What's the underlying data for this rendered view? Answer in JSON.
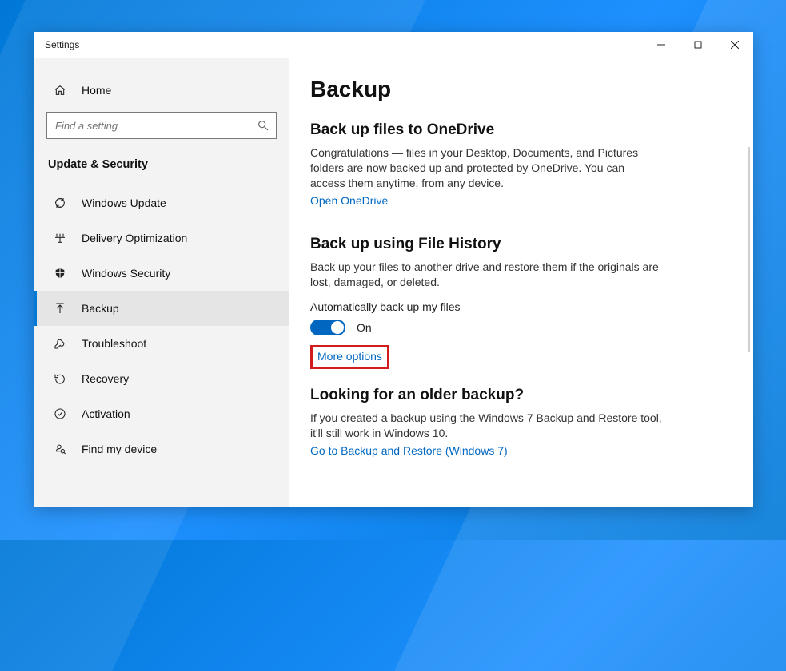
{
  "window": {
    "title": "Settings"
  },
  "home_label": "Home",
  "search": {
    "placeholder": "Find a setting"
  },
  "section_label": "Update & Security",
  "nav": [
    {
      "key": "windows-update",
      "label": "Windows Update"
    },
    {
      "key": "delivery-optimization",
      "label": "Delivery Optimization"
    },
    {
      "key": "windows-security",
      "label": "Windows Security"
    },
    {
      "key": "backup",
      "label": "Backup",
      "selected": true
    },
    {
      "key": "troubleshoot",
      "label": "Troubleshoot"
    },
    {
      "key": "recovery",
      "label": "Recovery"
    },
    {
      "key": "activation",
      "label": "Activation"
    },
    {
      "key": "find-my-device",
      "label": "Find my device"
    }
  ],
  "main": {
    "title": "Backup",
    "s1_heading": "Back up files to OneDrive",
    "s1_body": "Congratulations — files in your Desktop, Documents, and Pictures folders are now backed up and protected by OneDrive. You can access them anytime, from any device.",
    "s1_link": "Open OneDrive",
    "s2_heading": "Back up using File History",
    "s2_body": "Back up your files to another drive and restore them if the originals are lost, damaged, or deleted.",
    "s2_toggle_label": "Automatically back up my files",
    "s2_toggle_state": "On",
    "s2_link": "More options",
    "s3_heading": "Looking for an older backup?",
    "s3_body": "If you created a backup using the Windows 7 Backup and Restore tool, it'll still work in Windows 10.",
    "s3_link": "Go to Backup and Restore (Windows 7)"
  }
}
